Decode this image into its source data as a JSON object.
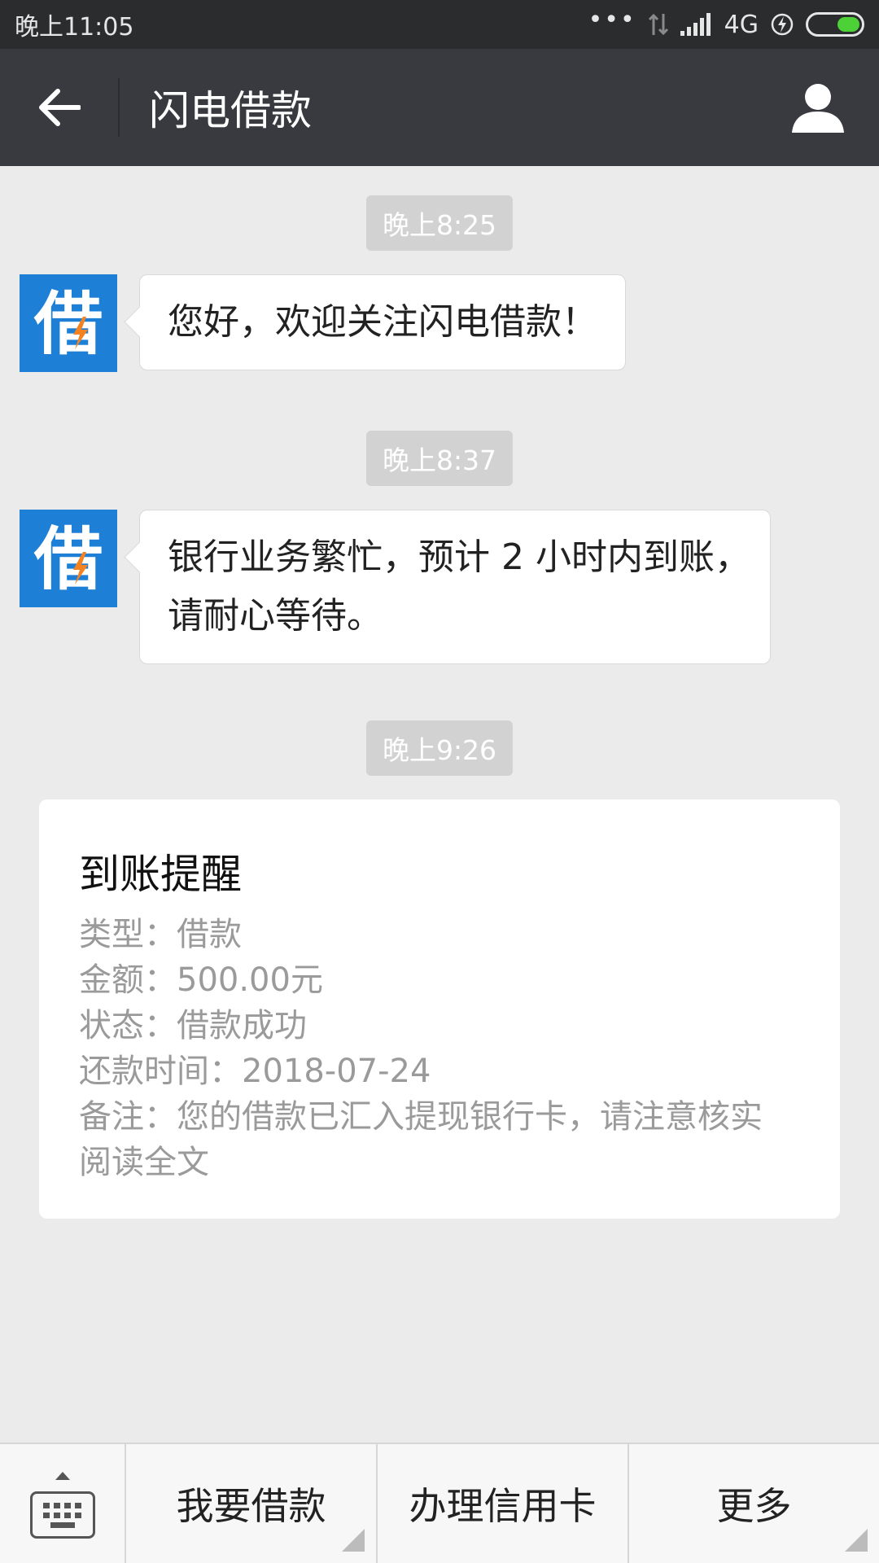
{
  "status_bar": {
    "time": "晚上11:05",
    "network": "4G",
    "battery_level": 0.45,
    "icons": [
      "more-dots-icon",
      "data-arrows-icon",
      "signal-icon",
      "charging-icon",
      "battery-icon"
    ]
  },
  "nav": {
    "title": "闪电借款",
    "back_icon": "arrow-left-icon",
    "profile_icon": "person-icon"
  },
  "messages": [
    {
      "time": "晚上8:25",
      "avatar_char": "借",
      "text": "您好，欢迎关注闪电借款！"
    },
    {
      "time": "晚上8:37",
      "avatar_char": "借",
      "text_line1": "银行业务繁忙，预计 2 小时内到账，",
      "text_line2": "请耐心等待。"
    }
  ],
  "card": {
    "time": "晚上9:26",
    "title": "到账提醒",
    "lines": [
      "类型：借款",
      "金额：500.00元",
      "状态：借款成功",
      "还款时间：2018-07-24",
      "备注：您的借款已汇入提现银行卡，请注意核实"
    ],
    "read_more": "阅读全文"
  },
  "bottom_menu": {
    "keyboard_icon": "keyboard-icon",
    "items": [
      "我要借款",
      "办理信用卡",
      "更多"
    ]
  },
  "colors": {
    "nav_bg": "#393a3f",
    "status_bg": "#2b2c2e",
    "chat_bg": "#ebebeb",
    "avatar_bg": "#1e7fd6",
    "lightning": "#f58220"
  }
}
